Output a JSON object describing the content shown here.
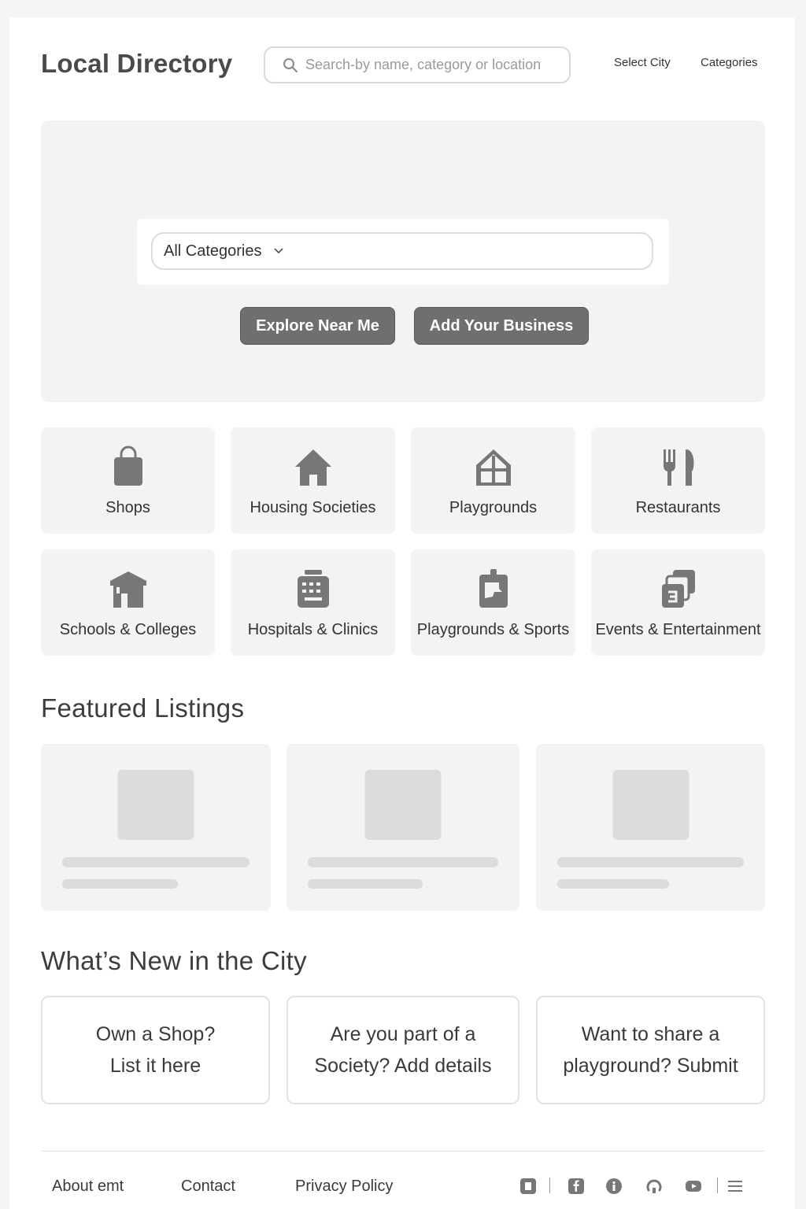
{
  "header": {
    "logo": "Local Directory",
    "search_placeholder": "Search-by name, category or location",
    "nav": {
      "city": "Select City",
      "categories": "Categories"
    }
  },
  "hero": {
    "select_value": "All Categories",
    "explore_button": "Explore Near Me",
    "add_button": "Add Your Business"
  },
  "categories": [
    {
      "label": "Shops",
      "icon": "shopping-bag-icon"
    },
    {
      "label": "Housing Societies",
      "icon": "house-icon"
    },
    {
      "label": "Playgrounds",
      "icon": "playground-icon"
    },
    {
      "label": "Restaurants",
      "icon": "fork-knife-icon"
    },
    {
      "label": "Schools & Colleges",
      "icon": "school-icon"
    },
    {
      "label": "Hospitals & Clinics",
      "icon": "hospital-icon"
    },
    {
      "label": "Playgrounds & Sports",
      "icon": "sports-icon"
    },
    {
      "label": "Events & Entertainment",
      "icon": "events-icon"
    }
  ],
  "featured": {
    "title": "Featured Listings"
  },
  "whats_new": {
    "title": "What’s New in the City",
    "cards": [
      {
        "line1": "Own a Shop?",
        "line2": "List it here"
      },
      {
        "line1": "Are you part of a",
        "line2": "Society? Add details"
      },
      {
        "line1": "Want to share a",
        "line2": "playground? Submit"
      }
    ]
  },
  "footer": {
    "links": [
      "About emt",
      "Contact",
      "Privacy Policy"
    ],
    "social_icons": [
      "square-icon",
      "facebook-icon",
      "info-icon",
      "github-icon",
      "youtube-icon",
      "menu-icon"
    ]
  },
  "colors": {
    "button": "#6f6f6f",
    "card_bg": "#f3f3f3",
    "placeholder": "#dcdcdc"
  }
}
